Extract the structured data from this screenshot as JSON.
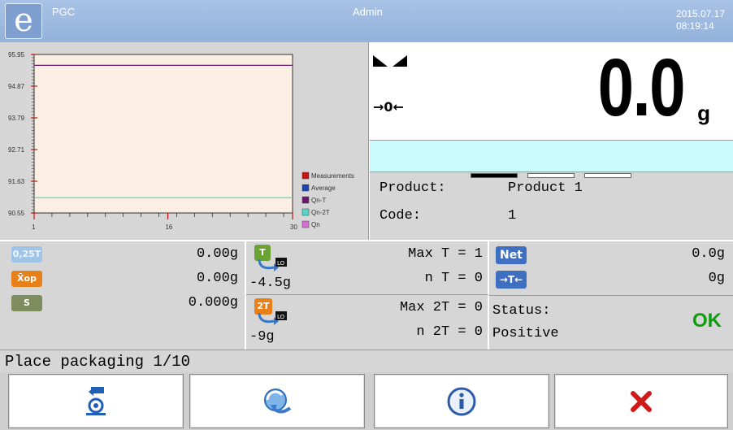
{
  "header": {
    "logo_letter": "e",
    "app_name": "PGC",
    "user": "Admin",
    "date": "2015.07.17",
    "time": "08:19:14"
  },
  "chart_data": {
    "type": "line",
    "y_ticks": [
      "95.95",
      "94.87",
      "93.79",
      "92.71",
      "91.63",
      "90.55"
    ],
    "x_ticks": [
      "1",
      "16",
      "30"
    ],
    "ylim": [
      90.55,
      95.95
    ],
    "xlim": [
      1,
      30
    ],
    "series": [
      {
        "name": "Measurements",
        "color": "#cc1111",
        "values": []
      },
      {
        "name": "Average",
        "color": "#2244aa",
        "values": []
      },
      {
        "name": "Qn-T",
        "color": "#6a1a6a",
        "y": 95.58
      },
      {
        "name": "Qn-2T",
        "color": "#55d6c8",
        "y": 91.07
      },
      {
        "name": "Qn",
        "color": "#d36fd3",
        "values": []
      }
    ],
    "plot_bg": "#fbeee2"
  },
  "weight": {
    "stable_icon": "stable-icon",
    "zero_symbol": "→0←",
    "value": "0.0",
    "unit": "g"
  },
  "product": {
    "product_label": "Product:",
    "product_value": "Product 1",
    "code_label": "Code:",
    "code_value": "1"
  },
  "stats": {
    "badge_tol": "0,25T",
    "val_tol": "0.00g",
    "badge_xop": "X̄op",
    "val_xop": "0.00g",
    "badge_s": "S",
    "val_s": "0.000g",
    "t_badge": "T",
    "t_value": "-4.5g",
    "max_t": "Max T = 1",
    "n_t": "n T = 0",
    "t2_badge": "2T",
    "t2_value": "-9g",
    "max_2t": "Max 2T = 0",
    "n_2t": "n 2T = 0",
    "net_badge": "Net",
    "net_value": "0.0g",
    "tare_badge": "→T←",
    "tare_value": "0g",
    "status_label": "Status:",
    "status_value": "Positive",
    "status_ok": "OK"
  },
  "message": "Place packaging 1/10",
  "buttons": {
    "tare_icon": "tare-packaging-icon",
    "exchange_icon": "exchange-icon",
    "info_icon": "info-icon",
    "close_icon": "close-icon"
  }
}
